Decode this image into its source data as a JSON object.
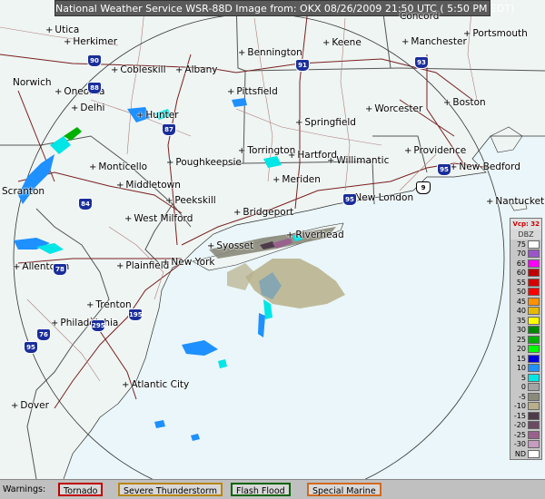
{
  "title": "National Weather Service WSR-88D Image from: OKX 08/26/2009 21:50 UTC ( 5:50 PM EDT)",
  "cities": [
    {
      "name": "Utica"
    },
    {
      "name": "Herkimer"
    },
    {
      "name": "Cobleskill"
    },
    {
      "name": "Albany"
    },
    {
      "name": "Bennington"
    },
    {
      "name": "Keene"
    },
    {
      "name": "Concord"
    },
    {
      "name": "Manchester"
    },
    {
      "name": "Portsmouth"
    },
    {
      "name": "Norwich"
    },
    {
      "name": "Oneonta"
    },
    {
      "name": "Pittsfield"
    },
    {
      "name": "Delhi"
    },
    {
      "name": "Hunter"
    },
    {
      "name": "Springfield"
    },
    {
      "name": "Worcester"
    },
    {
      "name": "Boston"
    },
    {
      "name": "Monticello"
    },
    {
      "name": "Poughkeepsie"
    },
    {
      "name": "Torrington"
    },
    {
      "name": "Hartford"
    },
    {
      "name": "Willimantic"
    },
    {
      "name": "Providence"
    },
    {
      "name": "New Bedford"
    },
    {
      "name": "Scranton"
    },
    {
      "name": "Middletown"
    },
    {
      "name": "Meriden"
    },
    {
      "name": "New London"
    },
    {
      "name": "Nantucket"
    },
    {
      "name": "Peekskill"
    },
    {
      "name": "Bridgeport"
    },
    {
      "name": "West Milford"
    },
    {
      "name": "Riverhead"
    },
    {
      "name": "Syosset"
    },
    {
      "name": "Allentown"
    },
    {
      "name": "Plainfield"
    },
    {
      "name": "New York"
    },
    {
      "name": "Trenton"
    },
    {
      "name": "Philadelphia"
    },
    {
      "name": "Atlantic City"
    },
    {
      "name": "Dover"
    }
  ],
  "shields": [
    {
      "num": "90",
      "kind": "i"
    },
    {
      "num": "88",
      "kind": "i"
    },
    {
      "num": "87",
      "kind": "i"
    },
    {
      "num": "91",
      "kind": "i"
    },
    {
      "num": "93",
      "kind": "i"
    },
    {
      "num": "84",
      "kind": "i"
    },
    {
      "num": "95",
      "kind": "i"
    },
    {
      "num": "95",
      "kind": "i"
    },
    {
      "num": "78",
      "kind": "i"
    },
    {
      "num": "76",
      "kind": "i"
    },
    {
      "num": "95",
      "kind": "i"
    },
    {
      "num": "295",
      "kind": "i"
    },
    {
      "num": "195",
      "kind": "i"
    },
    {
      "num": "9",
      "kind": "us"
    }
  ],
  "legend": {
    "header": "Vcp: 32",
    "unit": "DBZ",
    "rows": [
      {
        "label": "75",
        "color": "#ffffff"
      },
      {
        "label": "70",
        "color": "#9a55c9"
      },
      {
        "label": "65",
        "color": "#ff00ff"
      },
      {
        "label": "60",
        "color": "#c00000"
      },
      {
        "label": "55",
        "color": "#d60000"
      },
      {
        "label": "50",
        "color": "#ff0000"
      },
      {
        "label": "45",
        "color": "#ff9000"
      },
      {
        "label": "40",
        "color": "#e8b800"
      },
      {
        "label": "35",
        "color": "#ffff00"
      },
      {
        "label": "30",
        "color": "#008800"
      },
      {
        "label": "25",
        "color": "#00b000"
      },
      {
        "label": "20",
        "color": "#00ff00"
      },
      {
        "label": "15",
        "color": "#0000e0"
      },
      {
        "label": "10",
        "color": "#1e90ff"
      },
      {
        "label": "5",
        "color": "#00e5e5"
      },
      {
        "label": "0",
        "color": "#a4a4a4"
      },
      {
        "label": "-5",
        "color": "#8a8a7a"
      },
      {
        "label": "-10",
        "color": "#b7b08a"
      },
      {
        "label": "-15",
        "color": "#4d3b4a"
      },
      {
        "label": "-20",
        "color": "#6b4a63"
      },
      {
        "label": "-25",
        "color": "#98628d"
      },
      {
        "label": "-30",
        "color": "#c79cc1"
      },
      {
        "label": "ND",
        "color": "#ffffff"
      }
    ]
  },
  "warnings": {
    "label": "Warnings:",
    "items": [
      {
        "text": "Tornado",
        "color": "#c00000"
      },
      {
        "text": "Severe Thunderstorm",
        "color": "#b8860b"
      },
      {
        "text": "Flash Flood",
        "color": "#006400"
      },
      {
        "text": "Special Marine",
        "color": "#d2691e"
      }
    ]
  }
}
